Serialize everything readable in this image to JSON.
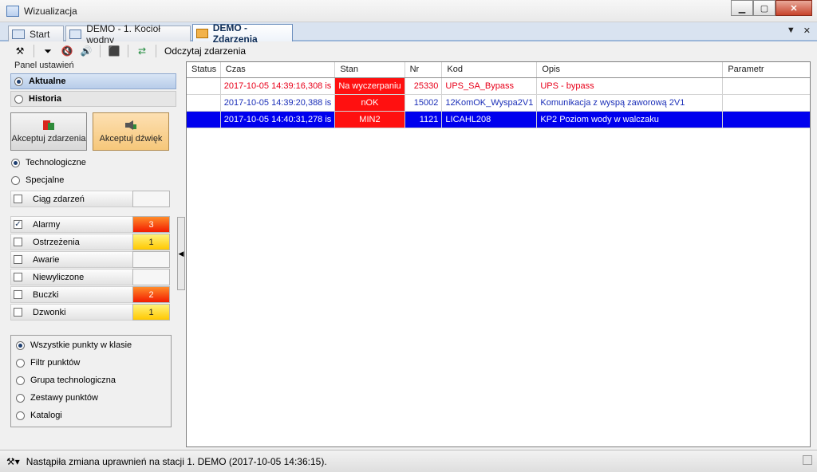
{
  "window": {
    "title": "Wizualizacja"
  },
  "tabs": [
    {
      "label": "Start",
      "active": false
    },
    {
      "label": "DEMO - 1. Kocioł wodny",
      "active": false
    },
    {
      "label": "DEMO - Zdarzenia",
      "active": true
    }
  ],
  "toolbar": {
    "read_events_label": "Odczytaj zdarzenia"
  },
  "panel": {
    "title": "Panel ustawień",
    "modes": [
      {
        "label": "Aktualne",
        "selected": true
      },
      {
        "label": "Historia",
        "selected": false
      }
    ],
    "ack_event_label": "Akceptuj zdarzenia",
    "ack_sound_label": "Akceptuj dźwięk",
    "categories": [
      {
        "label": "Technologiczne",
        "selected": true
      },
      {
        "label": "Specjalne",
        "selected": false
      }
    ],
    "sequence": {
      "label": "Ciąg zdarzeń",
      "checked": false
    },
    "filters": [
      {
        "label": "Alarmy",
        "checked": true,
        "count": "3",
        "color": "red"
      },
      {
        "label": "Ostrzeżenia",
        "checked": false,
        "count": "1",
        "color": "yellow"
      },
      {
        "label": "Awarie",
        "checked": false,
        "count": "",
        "color": "empty"
      },
      {
        "label": "Niewyliczone",
        "checked": false,
        "count": "",
        "color": "empty"
      },
      {
        "label": "Buczki",
        "checked": false,
        "count": "2",
        "color": "red"
      },
      {
        "label": "Dzwonki",
        "checked": false,
        "count": "1",
        "color": "yellow"
      }
    ],
    "point_filters": [
      {
        "label": "Wszystkie punkty w klasie",
        "selected": true
      },
      {
        "label": "Filtr punktów",
        "selected": false
      },
      {
        "label": "Grupa technologiczna",
        "selected": false
      },
      {
        "label": "Zestawy punktów",
        "selected": false
      },
      {
        "label": "Katalogi",
        "selected": false
      }
    ]
  },
  "grid": {
    "columns": [
      "Status",
      "Czas",
      "Stan",
      "Nr",
      "Kod",
      "Opis",
      "Parametr"
    ],
    "rows": [
      {
        "style": "r-red",
        "status": "",
        "time": "2017-10-05 14:39:16,308 is",
        "state": "Na wyczerpaniu",
        "nr": "25330",
        "code": "UPS_SA_Bypass",
        "desc": "UPS - bypass",
        "param": ""
      },
      {
        "style": "r-blue",
        "status": "",
        "time": "2017-10-05 14:39:20,388 is",
        "state": "nOK",
        "nr": "15002",
        "code": "12KomOK_Wyspa2V1",
        "desc": "Komunikacja z wyspą zaworową 2V1",
        "param": ""
      },
      {
        "style": "r-sel",
        "status": "",
        "time": "2017-10-05 14:40:31,278 is",
        "state": "MIN2",
        "nr": "1121",
        "code": "LICAHL208",
        "desc": "KP2 Poziom wody w walczaku",
        "param": ""
      }
    ]
  },
  "statusbar": {
    "message": "Nastąpiła zmiana uprawnień na stacji 1. DEMO (2017-10-05 14:36:15)."
  },
  "colors": {
    "alarm_red": "#ff1010",
    "selection_blue": "#0000ee",
    "text_red": "#e8001a",
    "text_blue": "#1b2fb8"
  }
}
